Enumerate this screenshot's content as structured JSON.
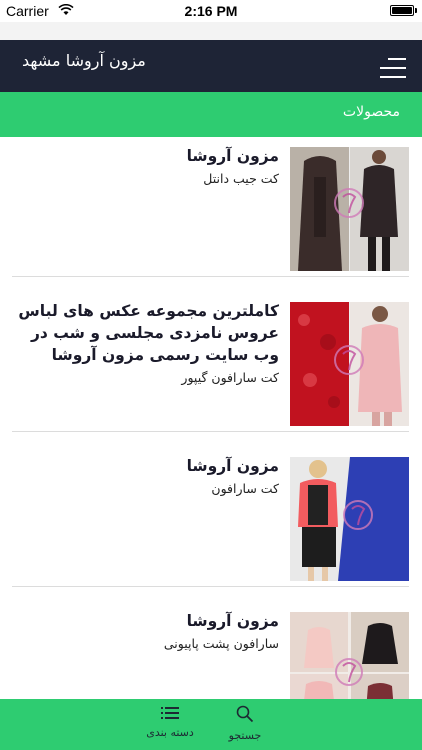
{
  "status_bar": {
    "carrier": "Carrier",
    "time": "2:16 PM"
  },
  "nav": {
    "title": "مزون آروشا مشهد",
    "menu_icon": "hamburger-menu-icon"
  },
  "section": {
    "label": "محصولات"
  },
  "products": [
    {
      "title": "مزون آروشا",
      "subtitle": "کت جیب دانتل"
    },
    {
      "title": "کاملترین مجموعه عکس های لباس عروس نامزدی مجلسی و شب در وب سایت رسمی مزون آروشا",
      "subtitle": "کت سارافون گیپور"
    },
    {
      "title": "مزون آروشا",
      "subtitle": "کت سارافون"
    },
    {
      "title": "مزون آروشا",
      "subtitle": "سارافون پشت پاپیونی"
    }
  ],
  "tabs": {
    "categories": {
      "label": "دسته بندی",
      "icon": "list-icon"
    },
    "search": {
      "label": "جستجو",
      "icon": "search-icon"
    }
  },
  "colors": {
    "nav_bg": "#1e2436",
    "accent_green": "#2ecc71"
  }
}
